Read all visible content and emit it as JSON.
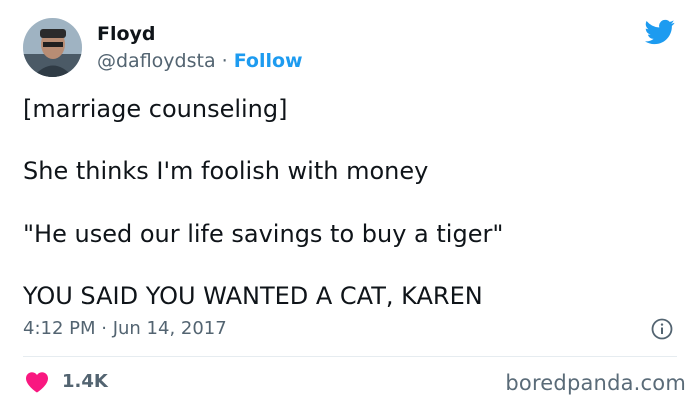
{
  "user": {
    "display_name": "Floyd",
    "handle": "@dafloydsta",
    "separator": " · ",
    "follow_label": "Follow"
  },
  "tweet": {
    "lines": [
      "[marriage counseling]",
      "She thinks I'm foolish with money",
      "\"He used our life savings to buy a tiger\"",
      "YOU SAID YOU WANTED A CAT, KAREN"
    ],
    "timestamp": "4:12 PM · Jun 14, 2017"
  },
  "engagement": {
    "likes": "1.4K"
  },
  "watermark": "boredpanda.com",
  "icons": {
    "brand": "twitter-bird-icon",
    "info": "info-icon",
    "like": "heart-icon"
  },
  "colors": {
    "accent": "#1d9bf0",
    "heart": "#f91880",
    "muted": "#536471"
  }
}
